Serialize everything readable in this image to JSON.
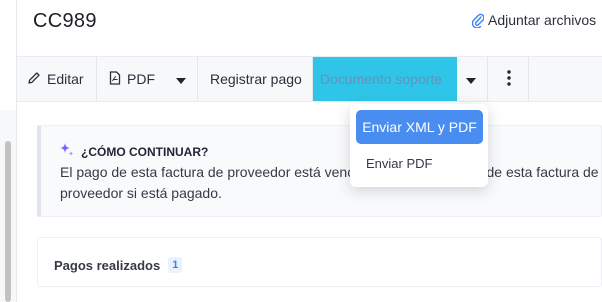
{
  "header": {
    "title": "CC989",
    "attach_label": "Adjuntar archivos"
  },
  "toolbar": {
    "edit_label": "Editar",
    "pdf_label": "PDF",
    "registrar_label": "Registrar pago",
    "soporte_label": "Documento soporte"
  },
  "dropdown": {
    "primary_label": "Enviar XML y PDF",
    "secondary_label": "Enviar PDF"
  },
  "guide": {
    "heading": "¿CÓMO CONTINUAR?",
    "line1": "El pago de esta factura de proveedor está vencido. Registra el pago de esta factura de",
    "line2": "proveedor si está pagado."
  },
  "payments": {
    "label": "Pagos realizados",
    "count": "1"
  },
  "colors": {
    "accent_blue": "#4a8df0",
    "highlight_cyan": "#2ec5e8",
    "sparkle_purple": "#7b61ff"
  },
  "icons": [
    "paperclip-icon",
    "pencil-icon",
    "pdf-file-icon",
    "caret-down-icon",
    "kebab-menu-icon",
    "sparkle-icon"
  ]
}
